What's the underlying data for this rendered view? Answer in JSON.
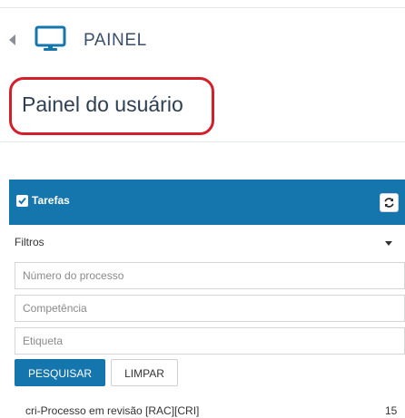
{
  "header": {
    "back_icon": "caret-left-icon",
    "section_icon": "monitor-icon",
    "section_title": "PAINEL"
  },
  "page": {
    "title": "Painel do usuário"
  },
  "tasks_panel": {
    "title": "Tarefas",
    "header_color": "#1576ad",
    "refresh_icon": "refresh-icon",
    "filters_label": "Filtros",
    "fields": {
      "process_number_placeholder": "Número do processo",
      "competence_placeholder": "Competência",
      "tag_placeholder": "Etiqueta"
    },
    "search_button": "PESQUISAR",
    "clear_button": "LIMPAR",
    "items": [
      {
        "label": "cri-Processo em revisão [RAC][CRI]",
        "count": "15"
      }
    ]
  },
  "annotation": {
    "color": "#d21f2a"
  }
}
